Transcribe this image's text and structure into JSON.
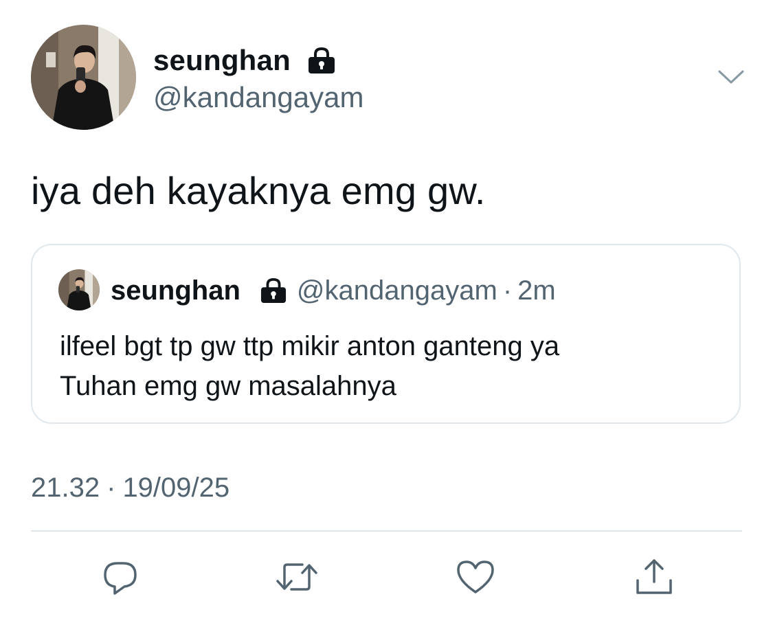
{
  "tweet": {
    "author": {
      "display_name": "seunghan",
      "handle": "@kandangayam",
      "protected_icon": "lock-icon"
    },
    "more_icon": "chevron-down-icon",
    "text": "iya deh kayaknya emg gw.",
    "quoted_tweet": {
      "display_name": "seunghan",
      "handle": "@kandangayam",
      "separator": "·",
      "time": "2m",
      "text_lines": [
        "ilfeel bgt tp gw ttp mikir anton ganteng ya",
        "Tuhan emg gw masalahnya"
      ]
    },
    "timestamp": {
      "time": "21.32",
      "separator": "·",
      "date": "19/09/25"
    },
    "actions": [
      {
        "name": "reply",
        "icon": "reply-icon"
      },
      {
        "name": "retweet",
        "icon": "retweet-icon"
      },
      {
        "name": "like",
        "icon": "heart-icon"
      },
      {
        "name": "share",
        "icon": "share-icon"
      }
    ]
  },
  "colors": {
    "text_primary": "#0f1419",
    "text_secondary": "#536471",
    "border": "#e1e8ed",
    "icon": "#536471"
  }
}
